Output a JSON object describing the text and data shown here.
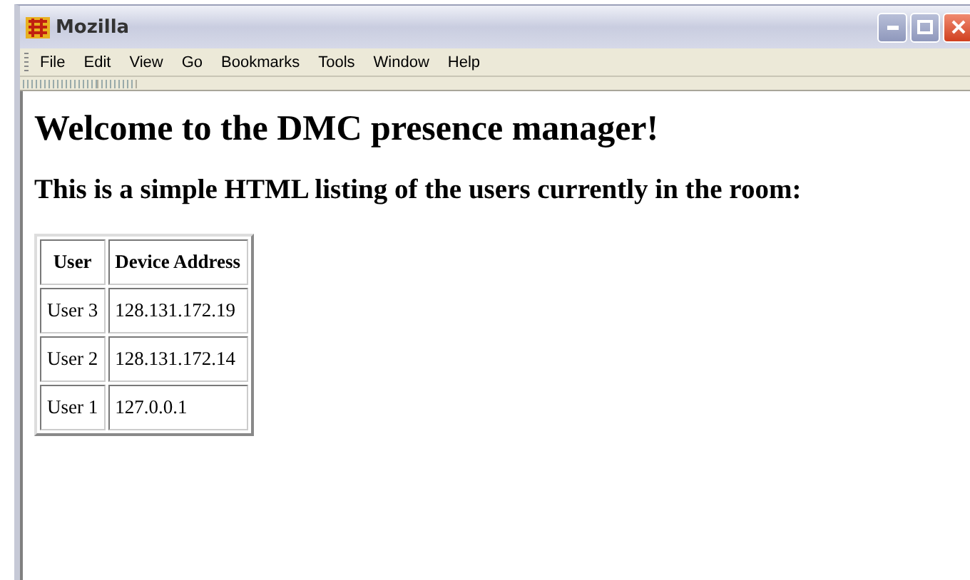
{
  "window": {
    "title": "Mozilla"
  },
  "menu": [
    "File",
    "Edit",
    "View",
    "Go",
    "Bookmarks",
    "Tools",
    "Window",
    "Help"
  ],
  "heading": "Welcome to the DMC presence manager!",
  "subheading": "This is a simple HTML listing of the users currently in the room:",
  "table": {
    "columns": [
      "User",
      "Device Address"
    ],
    "rows": [
      [
        "User 3",
        "128.131.172.19"
      ],
      [
        "User 2",
        "128.131.172.14"
      ],
      [
        "User 1",
        "127.0.0.1"
      ]
    ]
  }
}
